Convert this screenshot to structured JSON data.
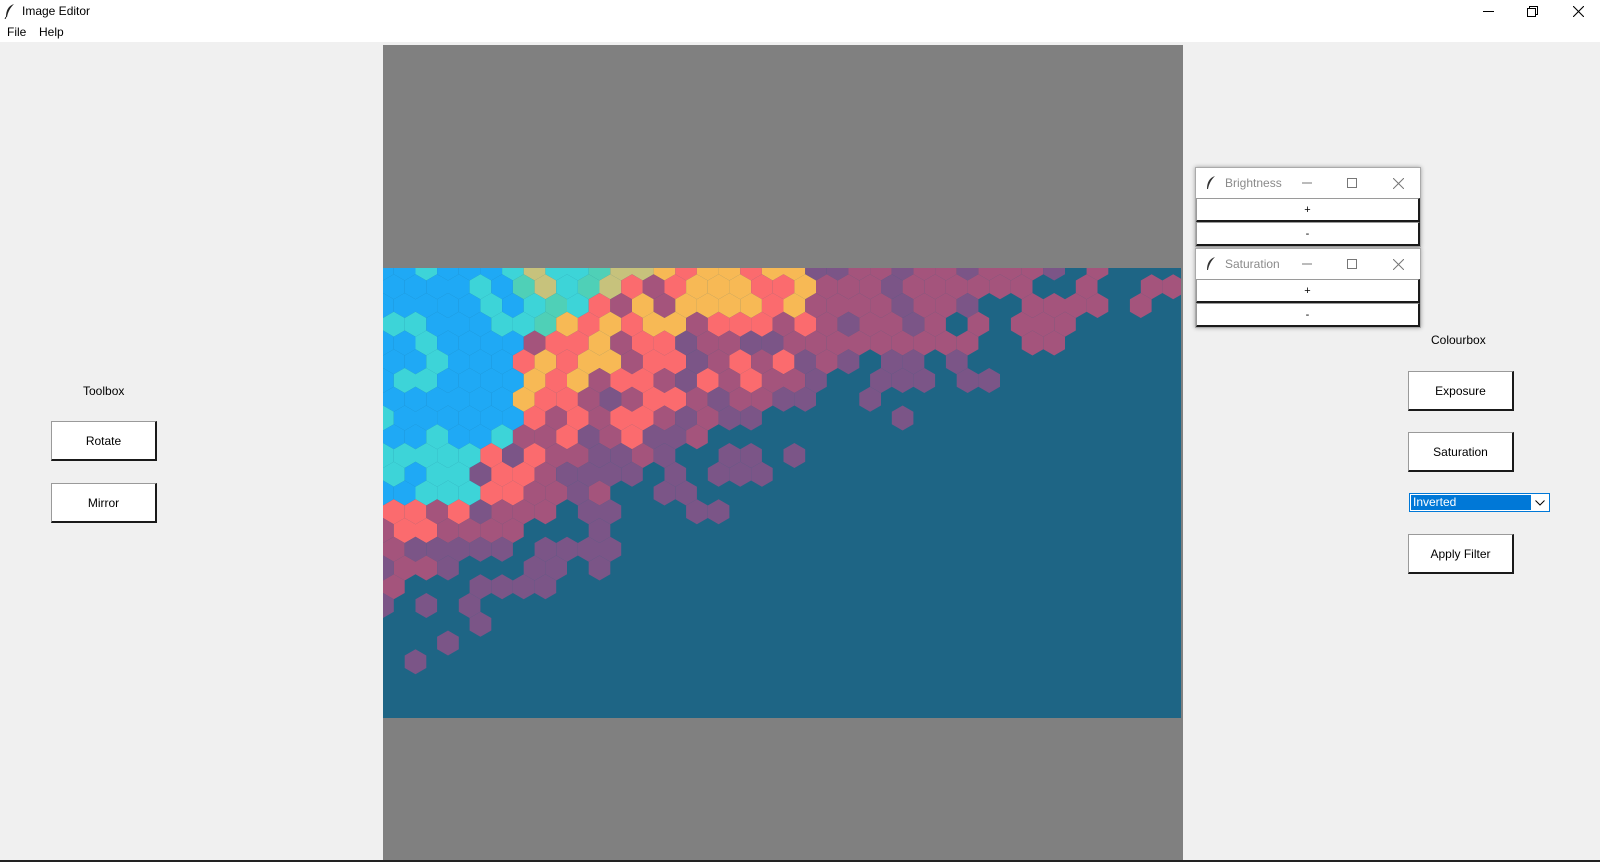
{
  "window": {
    "title": "Image Editor",
    "icons": {
      "app": "feather-icon",
      "minimize": "minimize-icon",
      "restore": "restore-icon",
      "close": "close-icon"
    }
  },
  "menubar": {
    "items": [
      "File",
      "Help"
    ]
  },
  "toolbox": {
    "label": "Toolbox",
    "buttons": [
      "Rotate",
      "Mirror"
    ]
  },
  "colourbox": {
    "label": "Colourbox",
    "buttons": [
      "Exposure",
      "Saturation"
    ],
    "filter_select": {
      "value": "Inverted"
    },
    "apply_label": "Apply Filter"
  },
  "brightness_window": {
    "title": "Brightness",
    "plus": "+",
    "minus": "-"
  },
  "saturation_window": {
    "title": "Saturation",
    "plus": "+",
    "minus": "-"
  },
  "colors": {
    "canvas_bg": "#808080",
    "photo_bg": "#1e6585",
    "hex_palette": [
      "#1fa9f5",
      "#3dd4d8",
      "#f7b955",
      "#fb6b6e",
      "#a4547c",
      "#7b5587",
      "#4fd0b7",
      "#c7c27c"
    ],
    "selection": "#0078d7"
  }
}
